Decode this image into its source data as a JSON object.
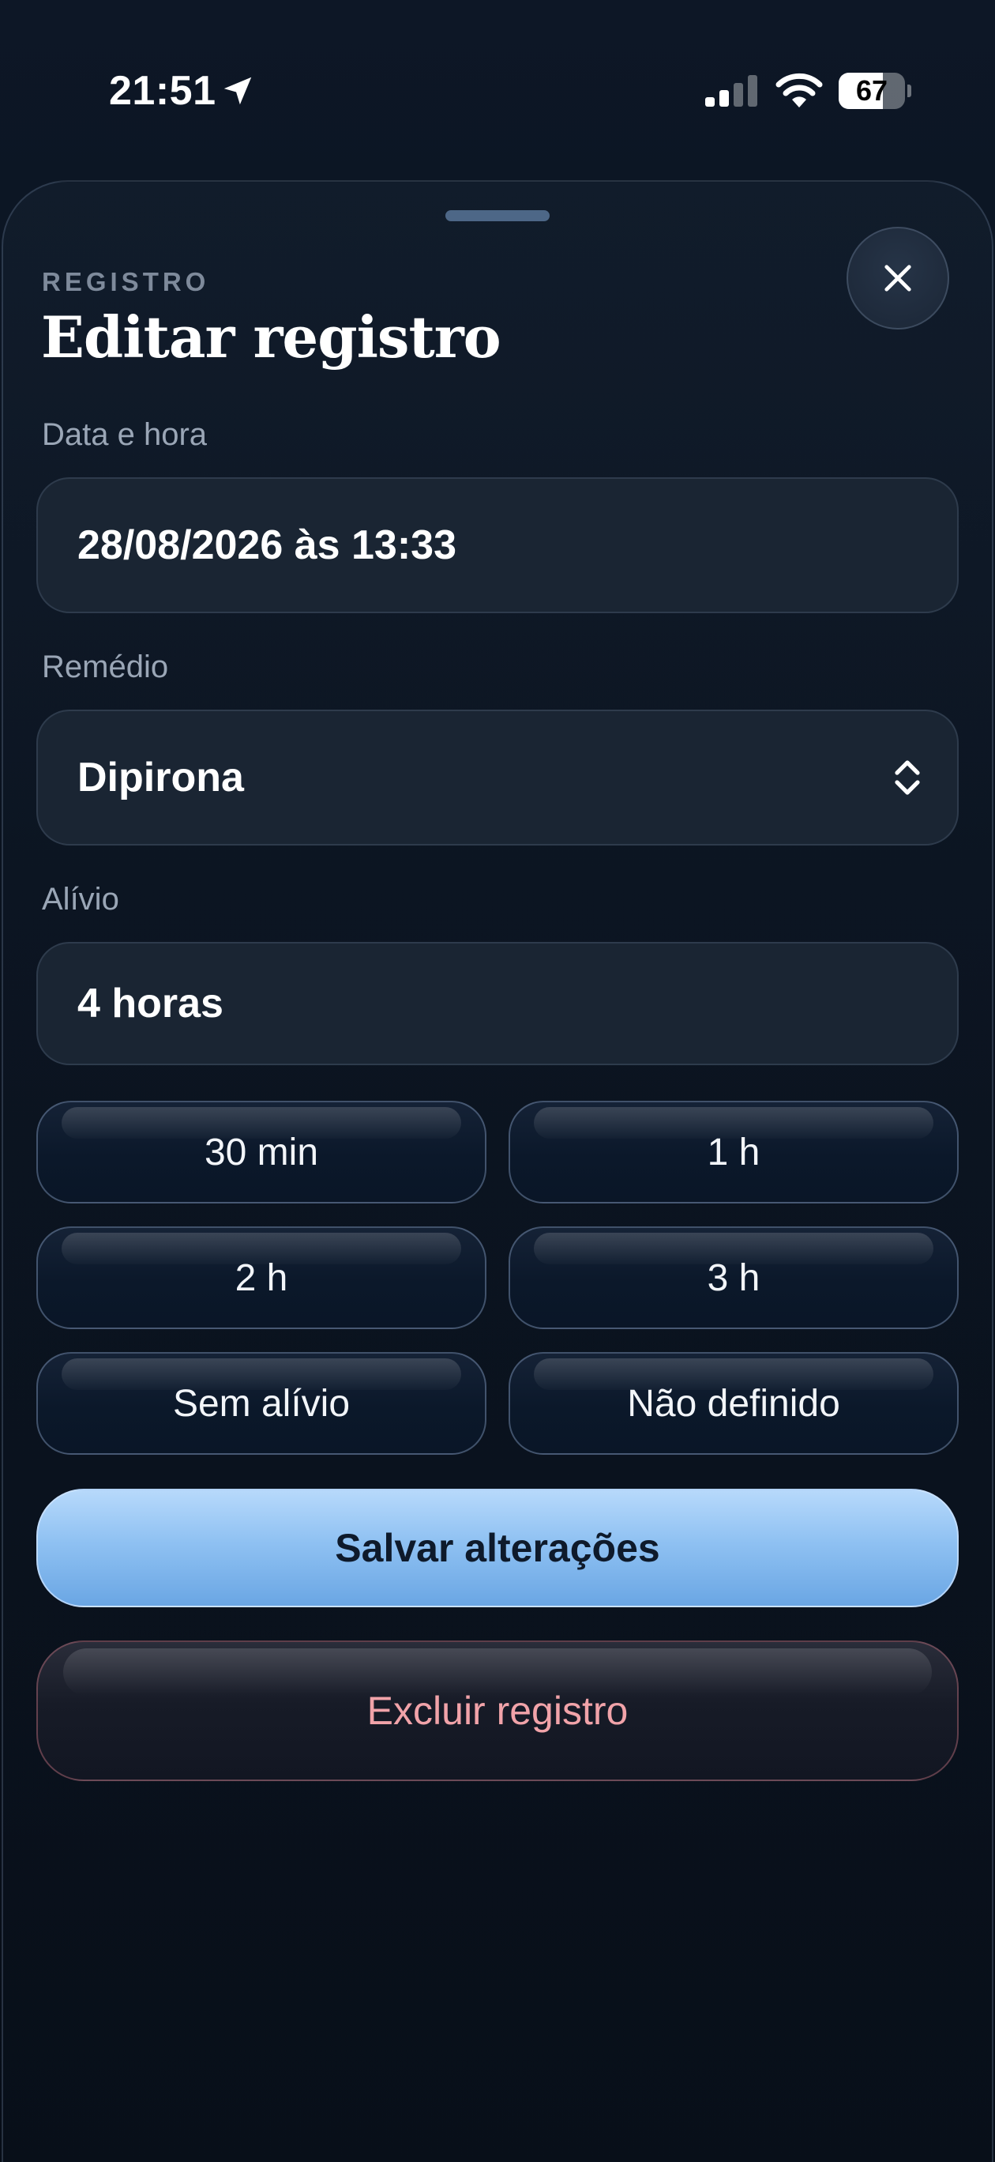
{
  "status_bar": {
    "time": "21:51",
    "battery_level": "67",
    "battery_fraction": 0.67
  },
  "sheet": {
    "eyebrow": "REGISTRO",
    "title": "Editar registro",
    "close_icon": "close-icon"
  },
  "form": {
    "datetime": {
      "label": "Data e hora",
      "value": "28/08/2026 às 13:33"
    },
    "medicine": {
      "label": "Remédio",
      "value": "Dipirona",
      "icon": "chevron-up-down-icon"
    },
    "relief": {
      "label": "Alívio",
      "value": "4 horas"
    },
    "presets": [
      {
        "label": "30 min"
      },
      {
        "label": "1 h"
      },
      {
        "label": "2 h"
      },
      {
        "label": "3 h"
      },
      {
        "label": "Sem alívio"
      },
      {
        "label": "Não definido"
      }
    ]
  },
  "actions": {
    "save_label": "Salvar alterações",
    "delete_label": "Excluir registro"
  },
  "colors": {
    "background": "#0a111c",
    "accent": "#8fc1f2",
    "danger_text": "#f1a3a9",
    "muted_text": "#9aa6b6"
  }
}
